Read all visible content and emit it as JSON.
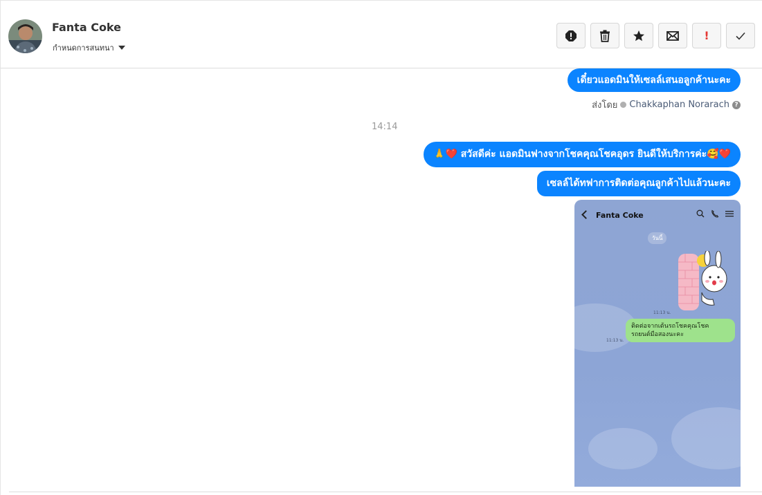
{
  "header": {
    "contact_name": "Fanta Coke",
    "conversation_label": "กำหนดการสนทนา"
  },
  "toolbar": {
    "buttons": [
      {
        "icon": "alert-circle-icon"
      },
      {
        "icon": "trash-icon"
      },
      {
        "icon": "star-icon"
      },
      {
        "icon": "envelope-icon"
      },
      {
        "icon": "exclamation-icon",
        "label": "!"
      },
      {
        "icon": "checkmark-icon"
      }
    ]
  },
  "messages": [
    {
      "text": "เดี๋ยวแอดมินให้เซลล์เสนอลูกค้านะคะ"
    },
    {
      "sent_by_prefix": "ส่งโดย",
      "agent": "Chakkaphan Norarach"
    },
    {
      "timestamp": "14:14"
    },
    {
      "text": "🙏❤️ สวัสดีค่ะ แอดมินฟางจากโชคคุณโชคอุดร ยินดีให้บริการค่ะ🥰❤️"
    },
    {
      "text": "เซลล์ได้ทฟาการติดต่อคุณลูกค้าไปแล้วนะคะ"
    }
  ],
  "attachment": {
    "chat_name": "Fanta Coke",
    "day_label": "วันนี้",
    "time_1": "11:13 น.",
    "time_2": "11:13 น.",
    "bubble_text": "ติดต่อจากเต้นรถโชคคุณโชค รถยนต์มือสองนะคะ"
  },
  "colors": {
    "accent": "#0b84ff",
    "line_green": "#9ee28c",
    "chat_bg": "#8ea5d3"
  }
}
